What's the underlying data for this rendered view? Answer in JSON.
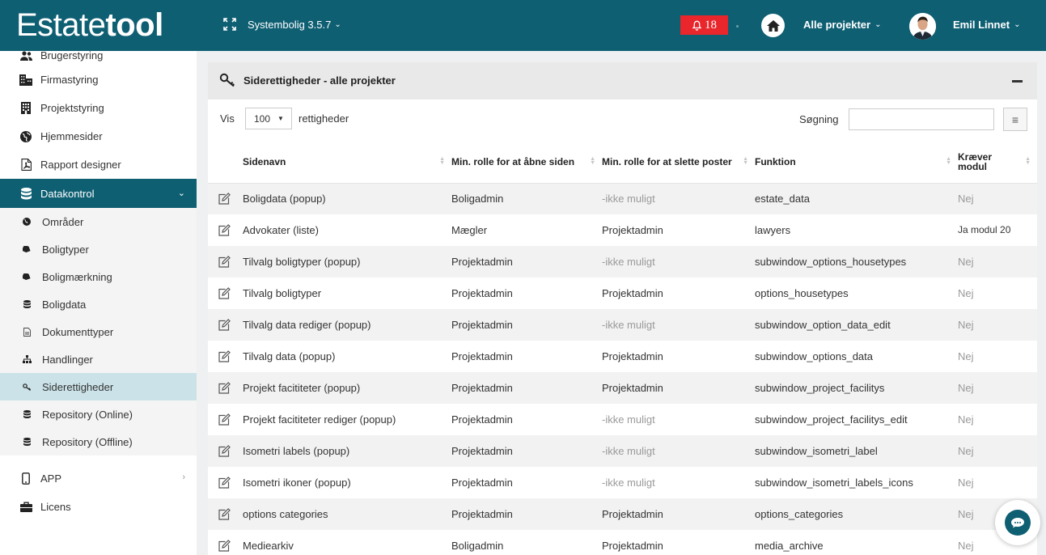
{
  "brand": {
    "logo_light": "Estate",
    "logo_bold": "tool"
  },
  "topbar": {
    "version": "Systembolig 3.5.7",
    "notifications": "18",
    "projects": "Alle projekter",
    "user": "Emil Linnet"
  },
  "sidebar": {
    "partial_top": "Brugerstyring",
    "items": [
      {
        "label": "Firmastyring",
        "icon": "building-icon"
      },
      {
        "label": "Projektstyring",
        "icon": "office-icon"
      },
      {
        "label": "Hjemmesider",
        "icon": "globe-icon"
      },
      {
        "label": "Rapport designer",
        "icon": "pdf-icon"
      }
    ],
    "active_group": "Datakontrol",
    "sub_items": [
      {
        "label": "Områder",
        "icon": "globe-small-icon"
      },
      {
        "label": "Boligtyper",
        "icon": "tag-icon"
      },
      {
        "label": "Boligmærkning",
        "icon": "tag-icon"
      },
      {
        "label": "Boligdata",
        "icon": "database-icon"
      },
      {
        "label": "Dokumenttyper",
        "icon": "file-icon"
      },
      {
        "label": "Handlinger",
        "icon": "sitemap-icon"
      },
      {
        "label": "Siderettigheder",
        "icon": "key-icon"
      },
      {
        "label": "Repository (Online)",
        "icon": "database-icon"
      },
      {
        "label": "Repository (Offline)",
        "icon": "database-icon"
      }
    ],
    "app_label": "APP",
    "license_label": "Licens"
  },
  "panel": {
    "title": "Siderettigheder - alle projekter",
    "show_label": "Vis",
    "page_size": "100",
    "rights_label": "rettigheder",
    "search_label": "Søgning",
    "search_value": ""
  },
  "table": {
    "headers": {
      "page": "Sidenavn",
      "open": "Min. rolle for at åbne siden",
      "delete": "Min. rolle for at slette poster",
      "func": "Funktion",
      "module": "Kræver modul"
    },
    "rows": [
      {
        "page": "Boligdata (popup)",
        "open": "Boligadmin",
        "delete": "-ikke muligt",
        "func": "estate_data",
        "module": "Nej"
      },
      {
        "page": "Advokater (liste)",
        "open": "Mægler",
        "delete": "Projektadmin",
        "func": "lawyers",
        "module": "Ja modul 20"
      },
      {
        "page": "Tilvalg boligtyper (popup)",
        "open": "Projektadmin",
        "delete": "-ikke muligt",
        "func": "subwindow_options_housetypes",
        "module": "Nej"
      },
      {
        "page": "Tilvalg boligtyper",
        "open": "Projektadmin",
        "delete": "Projektadmin",
        "func": "options_housetypes",
        "module": "Nej"
      },
      {
        "page": "Tilvalg data rediger (popup)",
        "open": "Projektadmin",
        "delete": "-ikke muligt",
        "func": "subwindow_option_data_edit",
        "module": "Nej"
      },
      {
        "page": "Tilvalg data (popup)",
        "open": "Projektadmin",
        "delete": "Projektadmin",
        "func": "subwindow_options_data",
        "module": "Nej"
      },
      {
        "page": "Projekt facititeter (popup)",
        "open": "Projektadmin",
        "delete": "Projektadmin",
        "func": "subwindow_project_facilitys",
        "module": "Nej"
      },
      {
        "page": "Projekt facititeter rediger (popup)",
        "open": "Projektadmin",
        "delete": "-ikke muligt",
        "func": "subwindow_project_facilitys_edit",
        "module": "Nej"
      },
      {
        "page": "Isometri labels (popup)",
        "open": "Projektadmin",
        "delete": "-ikke muligt",
        "func": "subwindow_isometri_label",
        "module": "Nej"
      },
      {
        "page": "Isometri ikoner (popup)",
        "open": "Projektadmin",
        "delete": "-ikke muligt",
        "func": "subwindow_isometri_labels_icons",
        "module": "Nej"
      },
      {
        "page": "options categories",
        "open": "Projektadmin",
        "delete": "Projektadmin",
        "func": "options_categories",
        "module": "Nej"
      },
      {
        "page": "Mediearkiv",
        "open": "Boligadmin",
        "delete": "Projektadmin",
        "func": "media_archive",
        "module": "Nej"
      }
    ]
  },
  "colors": {
    "brand": "#0f5f73",
    "alert": "#e8262b",
    "active_sub": "#cbe3e8"
  }
}
